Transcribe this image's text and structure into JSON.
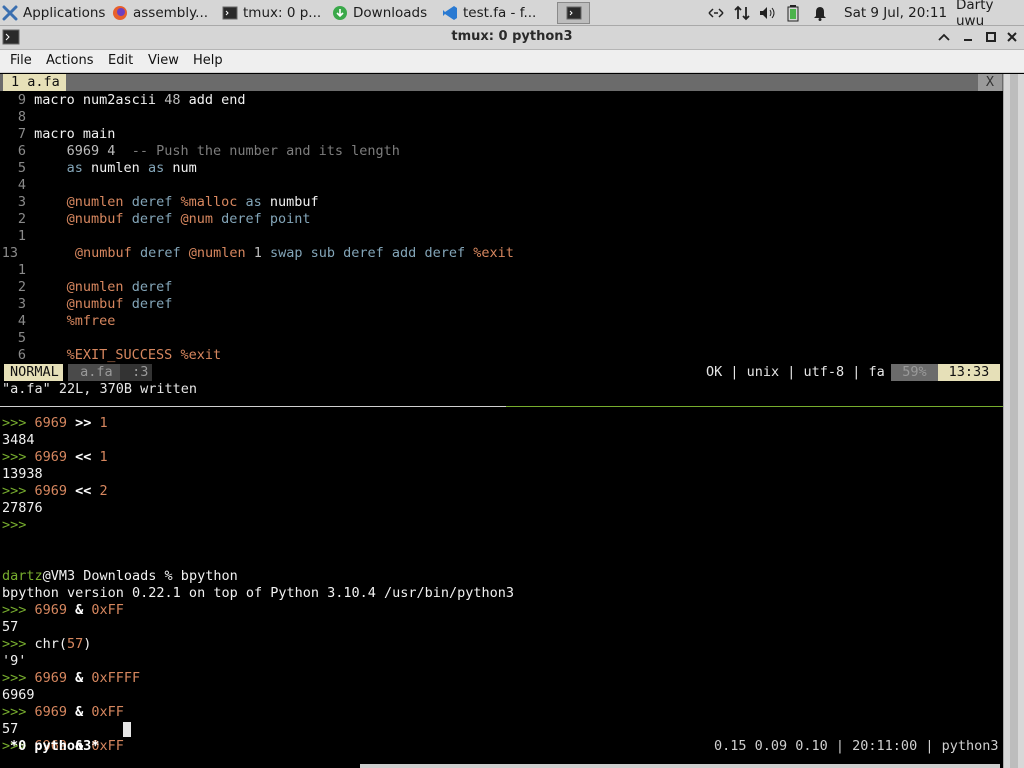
{
  "taskbar": {
    "applications_label": "Applications",
    "tasks": [
      {
        "label": "assembly..."
      },
      {
        "label": "tmux: 0 p..."
      },
      {
        "label": "Downloads"
      },
      {
        "label": "test.fa - f..."
      }
    ],
    "datetime": "Sat  9 Jul, 20:11",
    "user": "Darty uwu"
  },
  "window": {
    "title": "tmux: 0 python3",
    "menu": [
      "File",
      "Actions",
      "Edit",
      "View",
      "Help"
    ]
  },
  "vim": {
    "tab_label": "1 a.fa",
    "tab_close": "X",
    "status_mode": "NORMAL",
    "status_file": " a.fa ",
    "status_pos": " :3",
    "status_info": "OK | unix | utf-8 | fa",
    "status_percent": "59%",
    "status_cursor": "13:33",
    "message": "\"a.fa\" 22L, 370B written",
    "lines": [
      {
        "ln": "9",
        "parts": [
          [
            "kw",
            "macro num2ascii "
          ],
          [
            "muted",
            "48 "
          ],
          [
            "kw",
            "add end"
          ]
        ]
      },
      {
        "ln": "8",
        "parts": []
      },
      {
        "ln": "7",
        "parts": [
          [
            "kw",
            "macro main"
          ]
        ]
      },
      {
        "ln": "6",
        "parts": [
          [
            "muted",
            "    6969 4  "
          ],
          [
            "cmt",
            "-- Push the number and its length"
          ]
        ]
      },
      {
        "ln": "5",
        "parts": [
          [
            "blue",
            "    as "
          ],
          [
            "kw",
            "numlen "
          ],
          [
            "blue",
            "as "
          ],
          [
            "kw",
            "num"
          ]
        ]
      },
      {
        "ln": "4",
        "parts": []
      },
      {
        "ln": "3",
        "parts": [
          [
            "orange",
            "    @numlen "
          ],
          [
            "blue",
            "deref "
          ],
          [
            "orange",
            "%malloc "
          ],
          [
            "blue",
            "as "
          ],
          [
            "kw",
            "numbuf"
          ]
        ]
      },
      {
        "ln": "2",
        "parts": [
          [
            "orange",
            "    @numbuf "
          ],
          [
            "blue",
            "deref "
          ],
          [
            "orange",
            "@num "
          ],
          [
            "blue",
            "deref point"
          ]
        ]
      },
      {
        "ln": "1",
        "parts": []
      },
      {
        "ln": "13",
        "parts": [
          [
            "orange",
            "    @numbuf "
          ],
          [
            "blue",
            "deref "
          ],
          [
            "orange",
            "@numlen "
          ],
          [
            "muted",
            "1 "
          ],
          [
            "blue",
            "swap sub deref add deref "
          ],
          [
            "orange",
            "%exit"
          ]
        ]
      },
      {
        "ln": "1",
        "parts": []
      },
      {
        "ln": "2",
        "parts": [
          [
            "orange",
            "    @numlen "
          ],
          [
            "blue",
            "deref"
          ]
        ]
      },
      {
        "ln": "3",
        "parts": [
          [
            "orange",
            "    @numbuf "
          ],
          [
            "blue",
            "deref"
          ]
        ]
      },
      {
        "ln": "4",
        "parts": [
          [
            "orange",
            "    %mfree"
          ]
        ]
      },
      {
        "ln": "5",
        "parts": []
      },
      {
        "ln": "6",
        "parts": [
          [
            "orange",
            "    %EXIT_SUCCESS %exit"
          ]
        ]
      }
    ]
  },
  "python": {
    "lines": [
      [
        [
          "green",
          ">>> "
        ],
        [
          "orange",
          "6969 "
        ],
        [
          "white",
          ">> "
        ],
        [
          "orange",
          "1"
        ]
      ],
      [
        [
          "kw",
          "3484"
        ]
      ],
      [
        [
          "green",
          ">>> "
        ],
        [
          "orange",
          "6969 "
        ],
        [
          "white",
          "<< "
        ],
        [
          "orange",
          "1"
        ]
      ],
      [
        [
          "kw",
          "13938"
        ]
      ],
      [
        [
          "green",
          ">>> "
        ],
        [
          "orange",
          "6969 "
        ],
        [
          "white",
          "<< "
        ],
        [
          "orange",
          "2"
        ]
      ],
      [
        [
          "kw",
          "27876"
        ]
      ],
      [
        [
          "green",
          ">>>"
        ]
      ],
      [],
      [],
      [
        [
          "green",
          "dartz"
        ],
        [
          "kw",
          "@VM3 Downloads % bpython"
        ]
      ],
      [
        [
          "kw",
          "bpython version 0.22.1 on top of Python 3.10.4 /usr/bin/python3"
        ]
      ],
      [
        [
          "green",
          ">>> "
        ],
        [
          "orange",
          "6969 "
        ],
        [
          "white",
          "& "
        ],
        [
          "orange",
          "0xFF"
        ]
      ],
      [
        [
          "kw",
          "57"
        ]
      ],
      [
        [
          "green",
          ">>> "
        ],
        [
          "kw",
          "chr("
        ],
        [
          "orange",
          "57"
        ],
        [
          "kw",
          ")"
        ]
      ],
      [
        [
          "kw",
          "'9'"
        ]
      ],
      [
        [
          "green",
          ">>> "
        ],
        [
          "orange",
          "6969 "
        ],
        [
          "white",
          "& "
        ],
        [
          "orange",
          "0xFFFF"
        ]
      ],
      [
        [
          "kw",
          "6969"
        ]
      ],
      [
        [
          "green",
          ">>> "
        ],
        [
          "orange",
          "6969 "
        ],
        [
          "white",
          "& "
        ],
        [
          "orange",
          "0xFF"
        ]
      ],
      [
        [
          "kw",
          "57"
        ]
      ],
      [
        [
          "green",
          ">>> "
        ],
        [
          "orange",
          "6969 "
        ],
        [
          "white",
          "& "
        ],
        [
          "orange",
          "0xFF"
        ]
      ]
    ]
  },
  "tmux": {
    "window_label": "*0 python3*",
    "status_right": "0.15 0.09 0.10 | 20:11:00 | python3"
  },
  "colors": {
    "accent_green": "#77ad2e",
    "orange": "#d7875f",
    "blue": "#83a5b8",
    "status_bg": "#e6e0b8"
  }
}
